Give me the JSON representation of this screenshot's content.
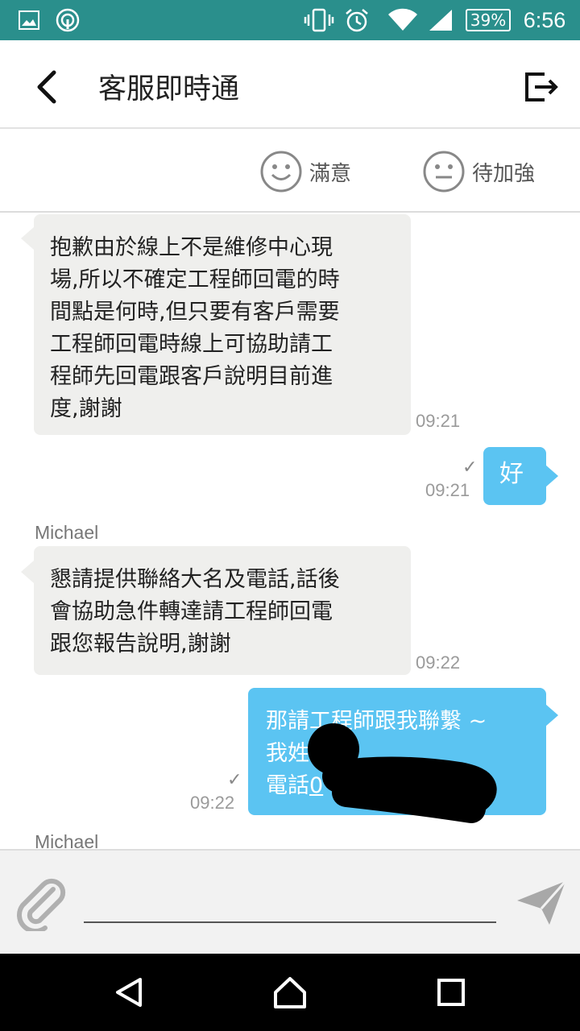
{
  "status_bar": {
    "battery": "39%",
    "time": "6:56",
    "icons": [
      "image-icon",
      "cast-icon",
      "vibrate-icon",
      "alarm-icon",
      "wifi-icon",
      "signal-icon",
      "battery-icon"
    ]
  },
  "app_bar": {
    "title": "客服即時通",
    "back_icon": "back-arrow-icon",
    "exit_icon": "exit-icon"
  },
  "rating": {
    "satisfied_label": "滿意",
    "improve_label": "待加強"
  },
  "messages": [
    {
      "direction": "incoming",
      "text": "抱歉由於線上不是維修中心現\n場,所以不確定工程師回電的時\n間點是何時,但只要有客戶需要\n工程師回電時線上可協助請工\n程師先回電跟客戶說明目前進\n度,謝謝",
      "time": "09:21"
    },
    {
      "direction": "outgoing",
      "text": "好",
      "time": "09:21",
      "read_mark": "✓"
    },
    {
      "direction": "incoming",
      "sender": "Michael",
      "text": "懇請提供聯絡大名及電話,話後\n會協助急件轉達請工程師回電\n跟您報告說明,謝謝",
      "time": "09:22"
    },
    {
      "direction": "outgoing",
      "line1": "那請工程師跟我聯繫 ~",
      "line2": "我姓",
      "line3_prefix": "電話",
      "line3_link": "0",
      "time": "09:22",
      "read_mark": "✓"
    },
    {
      "direction": "incoming",
      "sender": "Michael"
    }
  ],
  "input_bar": {
    "placeholder": "",
    "attach_icon": "paperclip-icon",
    "send_icon": "send-icon"
  },
  "nav_bar": {
    "icons": [
      "nav-back-icon",
      "nav-home-icon",
      "nav-recents-icon"
    ]
  },
  "colors": {
    "status_bar": "#2a8f8c",
    "outgoing_bubble": "#5bc4f2",
    "incoming_bubble": "#efefed"
  }
}
